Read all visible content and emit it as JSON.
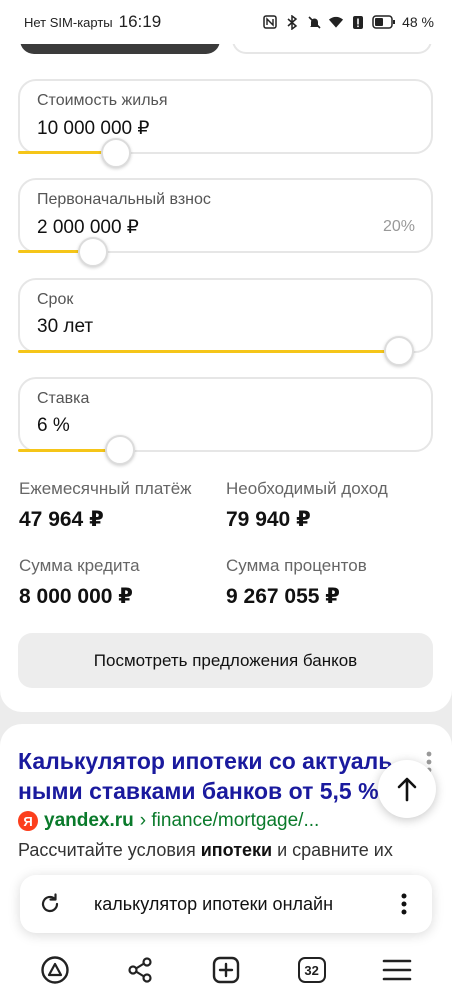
{
  "status_bar": {
    "carrier": "Нет SIM-карты",
    "time": "16:19",
    "battery": "48 %",
    "icons": [
      "nfc-icon",
      "bluetooth-icon",
      "mute-icon",
      "wifi-icon",
      "alert-icon",
      "battery-icon"
    ]
  },
  "calculator": {
    "price": {
      "label": "Стоимость жилья",
      "value": "10 000 000 ₽",
      "slider_fraction": 0.23
    },
    "down_payment": {
      "label": "Первоначальный взнос",
      "value": "2 000 000 ₽",
      "percent": "20%",
      "slider_fraction": 0.18
    },
    "term": {
      "label": "Срок",
      "value": "30 лет",
      "slider_fraction": 0.92
    },
    "rate": {
      "label": "Ставка",
      "value": "6 %",
      "slider_fraction": 0.25
    },
    "accent_color": "#f5c518"
  },
  "results": {
    "monthly_label": "Ежемесячный платёж",
    "monthly_value": "47 964 ₽",
    "income_label": "Необходимый доход",
    "income_value": "79 940 ₽",
    "loan_label": "Сумма кредита",
    "loan_value": "8 000 000 ₽",
    "interest_label": "Сумма процентов",
    "interest_value": "9 267 055 ₽"
  },
  "offers_button": "Посмотреть предложения банков",
  "search_result": {
    "title_line1": "Калькулятор ипотеки со актуаль",
    "title_line2": "ными ставками банков от 5,5 %",
    "favicon": "Я",
    "domain": "yandex.ru",
    "path": "› finance/mortgage/...",
    "snippet_before": "Рассчитайте условия ",
    "snippet_bold": "ипотеки",
    "snippet_after": " и сравните их"
  },
  "omnibox": {
    "query": "калькулятор ипотеки онлайн"
  },
  "bottom_nav": {
    "tabs_count": "32"
  }
}
